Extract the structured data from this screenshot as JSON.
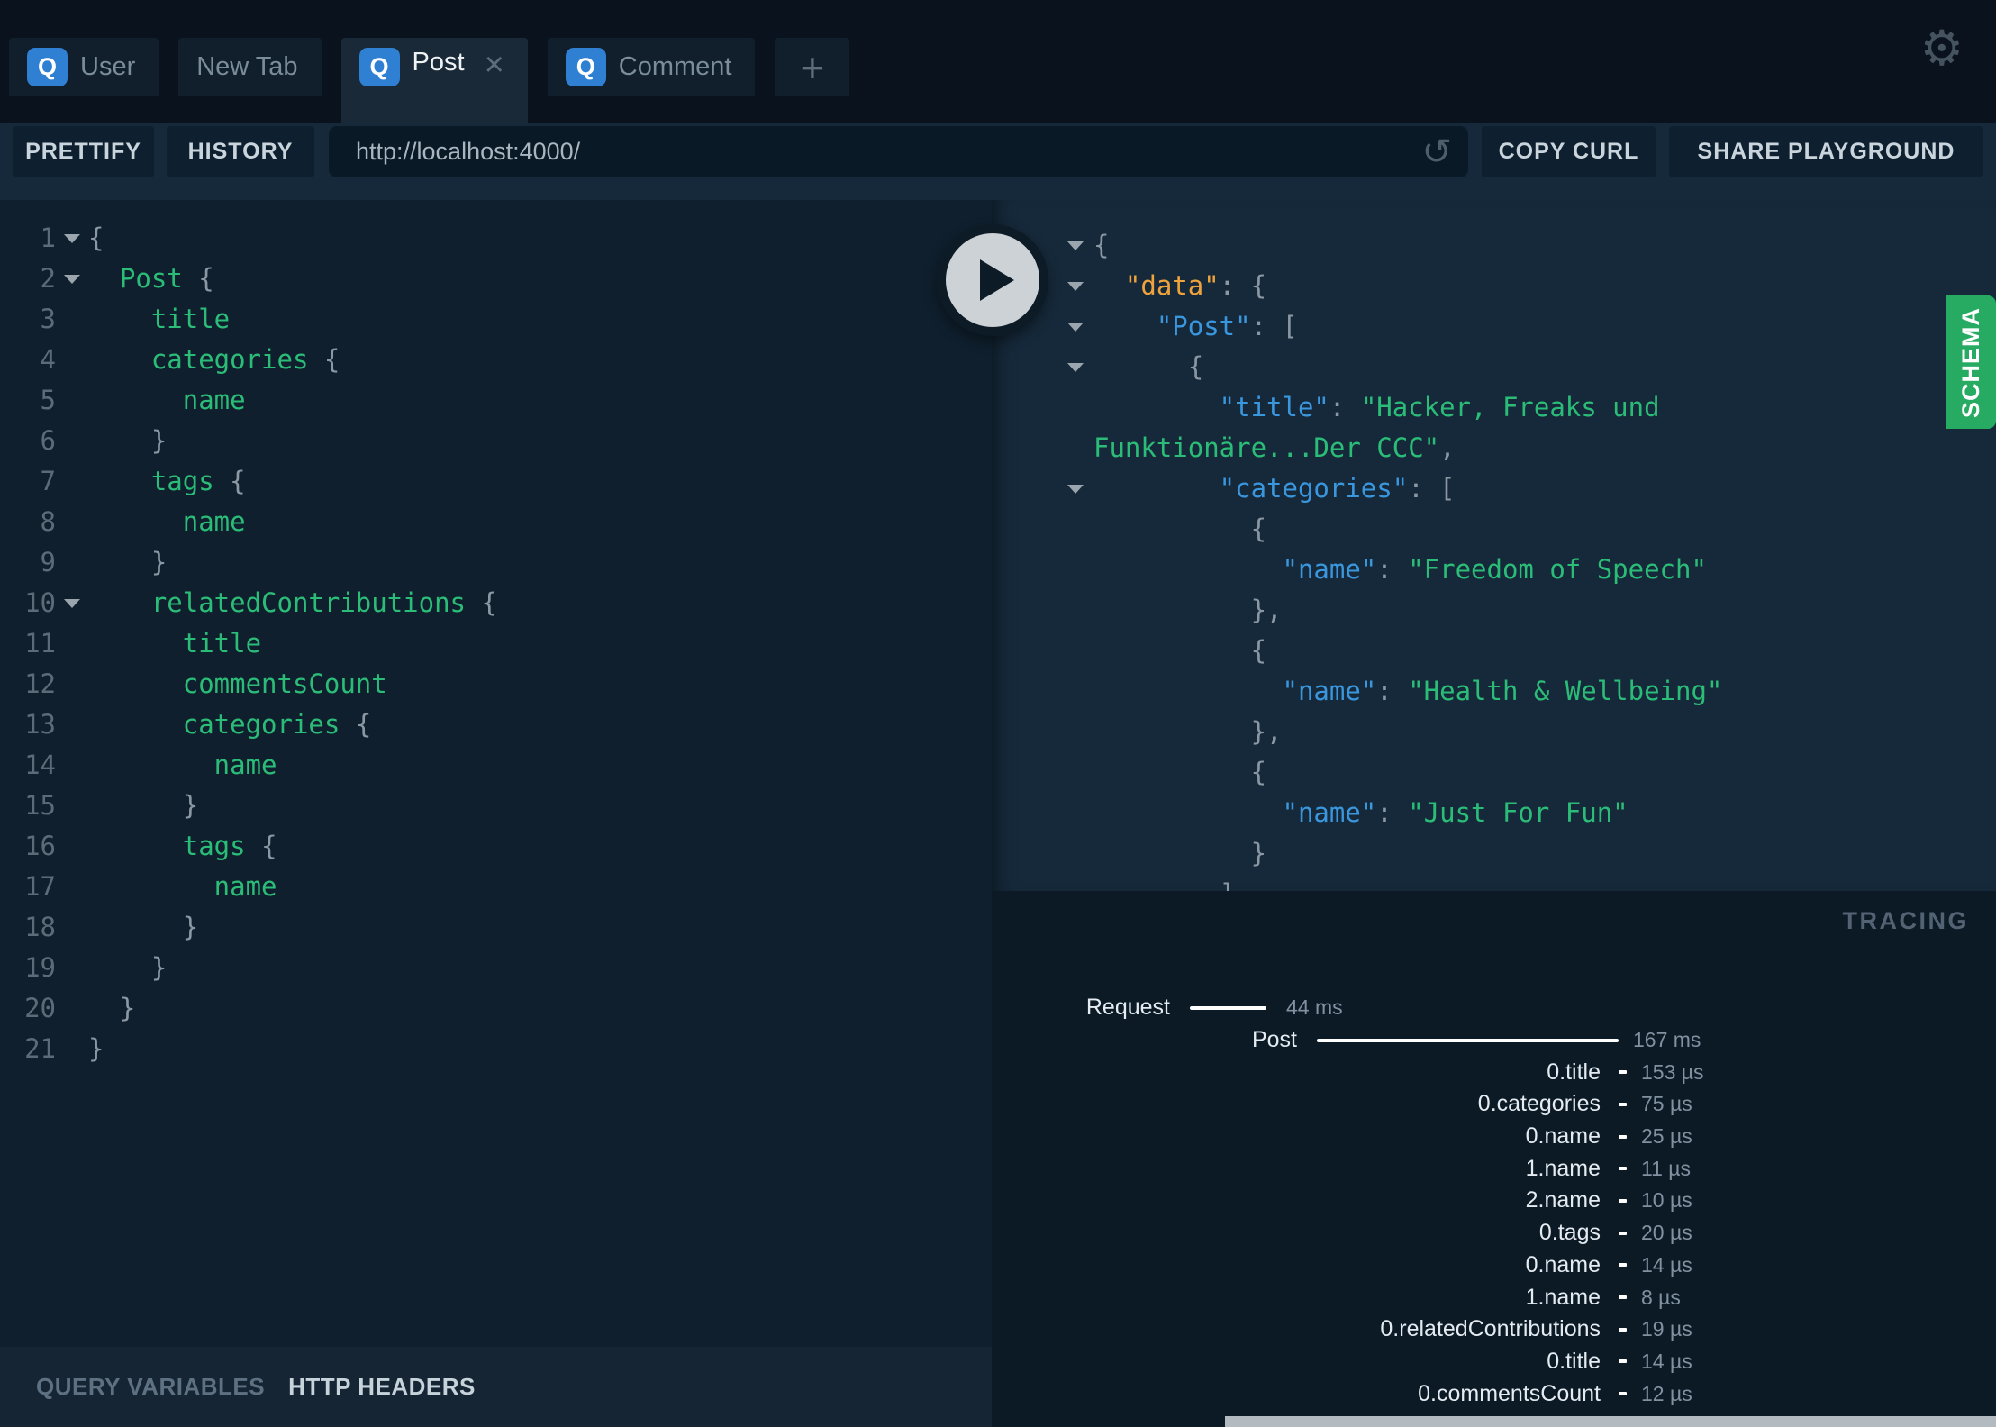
{
  "tabs": {
    "items": [
      {
        "badge": "Q",
        "label": "User",
        "active": false,
        "closable": false
      },
      {
        "badge": "",
        "label": "New Tab",
        "active": false,
        "closable": false
      },
      {
        "badge": "Q",
        "label": "Post",
        "active": true,
        "closable": true,
        "close_icon": "×"
      },
      {
        "badge": "Q",
        "label": "Comment",
        "active": false,
        "closable": false
      }
    ],
    "add_label": "+"
  },
  "icons": {
    "settings": "⚙",
    "reset": "↺",
    "play": "play-triangle",
    "fold": "triangle-down"
  },
  "toolbar": {
    "prettify": "PRETTIFY",
    "history": "HISTORY",
    "url": "http://localhost:4000/",
    "copy_curl": "COPY CURL",
    "share": "SHARE PLAYGROUND"
  },
  "editor": {
    "lines": [
      {
        "n": "1",
        "a": true,
        "i": 0,
        "t": [
          [
            "{",
            "p"
          ]
        ]
      },
      {
        "n": "2",
        "a": true,
        "i": 1,
        "t": [
          [
            "Post ",
            "f"
          ],
          [
            "{",
            "p"
          ]
        ]
      },
      {
        "n": "3",
        "a": false,
        "i": 2,
        "t": [
          [
            "title",
            "f"
          ]
        ]
      },
      {
        "n": "4",
        "a": false,
        "i": 2,
        "t": [
          [
            "categories ",
            "f"
          ],
          [
            "{",
            "p"
          ]
        ]
      },
      {
        "n": "5",
        "a": false,
        "i": 3,
        "t": [
          [
            "name",
            "f"
          ]
        ]
      },
      {
        "n": "6",
        "a": false,
        "i": 2,
        "t": [
          [
            "}",
            "p"
          ]
        ]
      },
      {
        "n": "7",
        "a": false,
        "i": 2,
        "t": [
          [
            "tags ",
            "f"
          ],
          [
            "{",
            "p"
          ]
        ]
      },
      {
        "n": "8",
        "a": false,
        "i": 3,
        "t": [
          [
            "name",
            "f"
          ]
        ]
      },
      {
        "n": "9",
        "a": false,
        "i": 2,
        "t": [
          [
            "}",
            "p"
          ]
        ]
      },
      {
        "n": "10",
        "a": true,
        "i": 2,
        "t": [
          [
            "relatedContributions ",
            "f"
          ],
          [
            "{",
            "p"
          ]
        ]
      },
      {
        "n": "11",
        "a": false,
        "i": 3,
        "t": [
          [
            "title",
            "f"
          ]
        ]
      },
      {
        "n": "12",
        "a": false,
        "i": 3,
        "t": [
          [
            "commentsCount",
            "f"
          ]
        ]
      },
      {
        "n": "13",
        "a": false,
        "i": 3,
        "t": [
          [
            "categories ",
            "f"
          ],
          [
            "{",
            "p"
          ]
        ]
      },
      {
        "n": "14",
        "a": false,
        "i": 4,
        "t": [
          [
            "name",
            "f"
          ]
        ]
      },
      {
        "n": "15",
        "a": false,
        "i": 3,
        "t": [
          [
            "}",
            "p"
          ]
        ]
      },
      {
        "n": "16",
        "a": false,
        "i": 3,
        "t": [
          [
            "tags ",
            "f"
          ],
          [
            "{",
            "p"
          ]
        ]
      },
      {
        "n": "17",
        "a": false,
        "i": 4,
        "t": [
          [
            "name",
            "f"
          ]
        ]
      },
      {
        "n": "18",
        "a": false,
        "i": 3,
        "t": [
          [
            "}",
            "p"
          ]
        ]
      },
      {
        "n": "19",
        "a": false,
        "i": 2,
        "t": [
          [
            "}",
            "p"
          ]
        ]
      },
      {
        "n": "20",
        "a": false,
        "i": 1,
        "t": [
          [
            "}",
            "p"
          ]
        ]
      },
      {
        "n": "21",
        "a": false,
        "i": 0,
        "t": [
          [
            "}",
            "p"
          ]
        ]
      }
    ]
  },
  "response": {
    "lines": [
      {
        "a": true,
        "i": 0,
        "t": [
          [
            "{",
            "p"
          ]
        ]
      },
      {
        "a": true,
        "i": 2,
        "t": [
          [
            "\"data\"",
            "o"
          ],
          [
            ": ",
            "p"
          ],
          [
            "{",
            "p"
          ]
        ]
      },
      {
        "a": true,
        "i": 4,
        "t": [
          [
            "\"Post\"",
            "k"
          ],
          [
            ": ",
            "p"
          ],
          [
            "[",
            "p"
          ]
        ]
      },
      {
        "a": true,
        "i": 6,
        "t": [
          [
            "{",
            "p"
          ]
        ]
      },
      {
        "a": false,
        "i": 8,
        "t": [
          [
            "\"title\"",
            "k"
          ],
          [
            ": ",
            "p"
          ],
          [
            "\"Hacker, Freaks und",
            "s"
          ]
        ]
      },
      {
        "a": false,
        "i": 0,
        "t": [
          [
            "Funktionäre...Der CCC\"",
            "s"
          ],
          [
            ",",
            "p"
          ]
        ]
      },
      {
        "a": true,
        "i": 8,
        "t": [
          [
            "\"categories\"",
            "k"
          ],
          [
            ": ",
            "p"
          ],
          [
            "[",
            "p"
          ]
        ]
      },
      {
        "a": false,
        "i": 10,
        "t": [
          [
            "{",
            "p"
          ]
        ]
      },
      {
        "a": false,
        "i": 12,
        "t": [
          [
            "\"name\"",
            "k"
          ],
          [
            ": ",
            "p"
          ],
          [
            "\"Freedom of Speech\"",
            "s"
          ]
        ]
      },
      {
        "a": false,
        "i": 10,
        "t": [
          [
            "},",
            "p"
          ]
        ]
      },
      {
        "a": false,
        "i": 10,
        "t": [
          [
            "{",
            "p"
          ]
        ]
      },
      {
        "a": false,
        "i": 12,
        "t": [
          [
            "\"name\"",
            "k"
          ],
          [
            ": ",
            "p"
          ],
          [
            "\"Health & Wellbeing\"",
            "s"
          ]
        ]
      },
      {
        "a": false,
        "i": 10,
        "t": [
          [
            "},",
            "p"
          ]
        ]
      },
      {
        "a": false,
        "i": 10,
        "t": [
          [
            "{",
            "p"
          ]
        ]
      },
      {
        "a": false,
        "i": 12,
        "t": [
          [
            "\"name\"",
            "k"
          ],
          [
            ": ",
            "p"
          ],
          [
            "\"Just For Fun\"",
            "s"
          ]
        ]
      },
      {
        "a": false,
        "i": 10,
        "t": [
          [
            "}",
            "p"
          ]
        ]
      },
      {
        "a": false,
        "i": 8,
        "t": [
          [
            "]",
            "p"
          ]
        ]
      }
    ]
  },
  "schema_tab_label": "SCHEMA",
  "tracing": {
    "title": "TRACING",
    "rows": [
      {
        "type": "request",
        "label": "Request",
        "value": "44 ms"
      },
      {
        "type": "post",
        "label": "Post",
        "value": "167 ms"
      },
      {
        "type": "field",
        "label": "0.title",
        "value": "153 µs"
      },
      {
        "type": "field",
        "label": "0.categories",
        "value": "75 µs"
      },
      {
        "type": "field",
        "label": "0.name",
        "value": "25 µs"
      },
      {
        "type": "field",
        "label": "1.name",
        "value": "11 µs"
      },
      {
        "type": "field",
        "label": "2.name",
        "value": "10 µs"
      },
      {
        "type": "field",
        "label": "0.tags",
        "value": "20 µs"
      },
      {
        "type": "field",
        "label": "0.name",
        "value": "14 µs"
      },
      {
        "type": "field",
        "label": "1.name",
        "value": "8 µs"
      },
      {
        "type": "field",
        "label": "0.relatedContributions",
        "value": "19 µs"
      },
      {
        "type": "field",
        "label": "0.title",
        "value": "14 µs"
      },
      {
        "type": "field",
        "label": "0.commentsCount",
        "value": "12 µs"
      }
    ]
  },
  "bottom_bar": {
    "query_variables": "QUERY VARIABLES",
    "http_headers": "HTTP HEADERS"
  },
  "colors": {
    "badge_blue": "#2f80d2",
    "schema_green": "#27ab62",
    "key_blue": "#3a96dd",
    "string_green": "#2bbd78",
    "root_orange": "#efa33c",
    "response_bg": "#16293a",
    "editor_bg": "#0f1f2d",
    "tracing_bg": "#0c1a26",
    "header_bg": "#0a131d"
  }
}
